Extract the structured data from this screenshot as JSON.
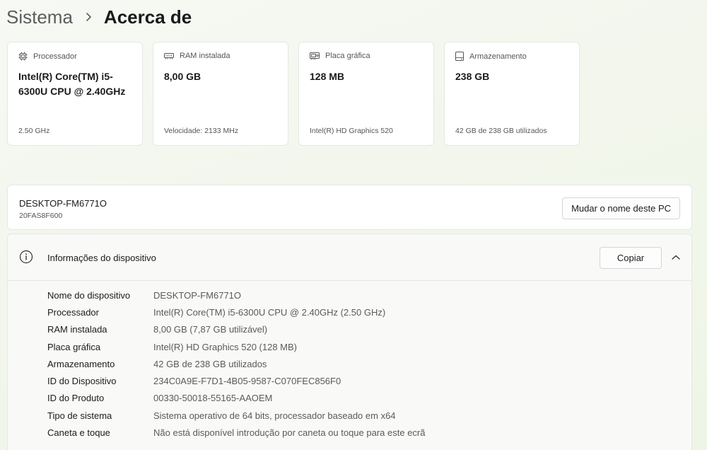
{
  "breadcrumb": {
    "parent": "Sistema",
    "current": "Acerca de"
  },
  "icons": {
    "chevron": "chevron-right-icon",
    "processor": "processor-chip-icon",
    "ram": "memory-icon",
    "graphics": "graphics-card-icon",
    "storage": "storage-drive-icon",
    "info": "info-icon",
    "collapse": "chevron-up-icon"
  },
  "cards": [
    {
      "label": "Processador",
      "value": "Intel(R) Core(TM) i5-6300U CPU @ 2.40GHz",
      "sub": "2.50 GHz"
    },
    {
      "label": "RAM instalada",
      "value": "8,00 GB",
      "sub": "Velocidade: 2133 MHz"
    },
    {
      "label": "Placa gráfica",
      "value": "128 MB",
      "sub": "Intel(R) HD Graphics 520"
    },
    {
      "label": "Armazenamento",
      "value": "238 GB",
      "sub": "42 GB de 238 GB utilizados"
    }
  ],
  "pc": {
    "name": "DESKTOP-FM6771O",
    "model": "20FAS8F600",
    "rename_label": "Mudar o nome deste PC"
  },
  "device_info": {
    "title": "Informações do dispositivo",
    "copy_label": "Copiar",
    "rows": [
      {
        "key": "Nome do dispositivo",
        "value": "DESKTOP-FM6771O"
      },
      {
        "key": "Processador",
        "value": "Intel(R) Core(TM) i5-6300U CPU @ 2.40GHz (2.50 GHz)"
      },
      {
        "key": "RAM instalada",
        "value": "8,00 GB (7,87 GB utilizável)"
      },
      {
        "key": "Placa gráfica",
        "value": "Intel(R) HD Graphics 520 (128 MB)"
      },
      {
        "key": "Armazenamento",
        "value": "42 GB de 238 GB utilizados"
      },
      {
        "key": "ID do Dispositivo",
        "value": "234C0A9E-F7D1-4B05-9587-C070FEC856F0"
      },
      {
        "key": "ID do Produto",
        "value": "00330-50018-55165-AAOEM"
      },
      {
        "key": "Tipo de sistema",
        "value": "Sistema operativo de 64 bits, processador baseado em x64"
      },
      {
        "key": "Caneta e toque",
        "value": "Não está disponível introdução por caneta ou toque para este ecrã"
      }
    ]
  }
}
